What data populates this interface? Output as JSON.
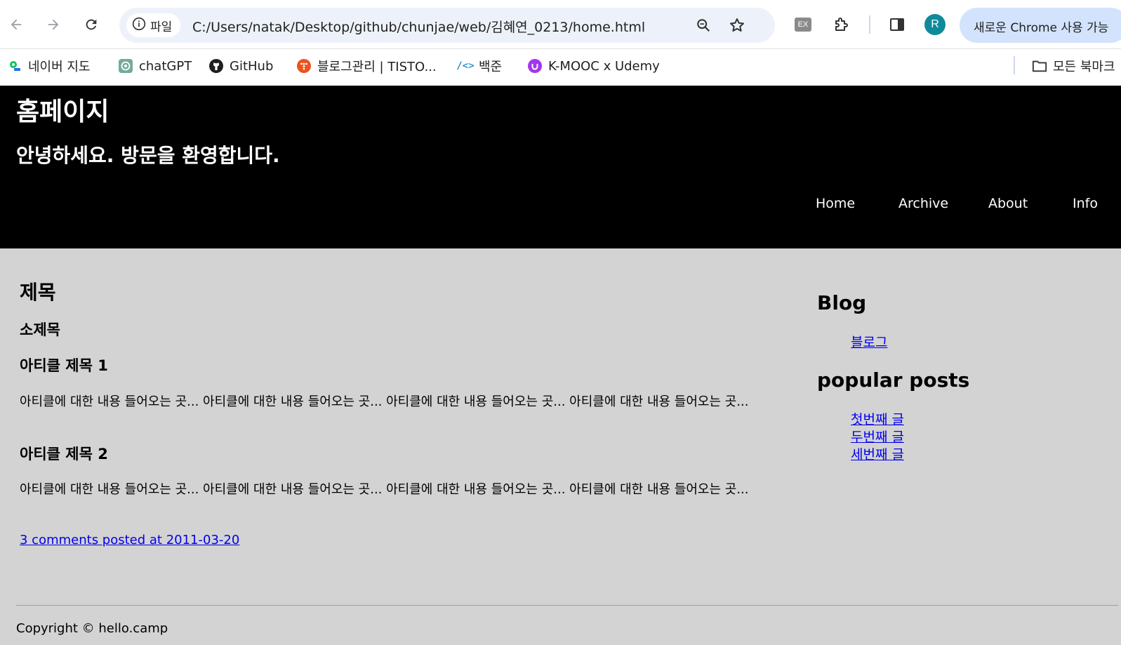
{
  "browser": {
    "chip_label": "파일",
    "url": "C:/Users/natak/Desktop/github/chunjae/web/김혜연_0213/home.html",
    "profile_initial": "R",
    "promo_text": "새로운 Chrome 사용 가능",
    "ext_label": "EX",
    "accent_color": "#d3e3fd"
  },
  "bookmarks": {
    "items": [
      {
        "label": "네이버 지도",
        "icon": "naver-map-icon"
      },
      {
        "label": "chatGPT",
        "icon": "chatgpt-icon"
      },
      {
        "label": "GitHub",
        "icon": "github-icon"
      },
      {
        "label": "블로그관리 | TISTO...",
        "icon": "tistory-icon"
      },
      {
        "label": "백준",
        "icon": "baekjoon-icon"
      },
      {
        "label": "K-MOOC x Udemy",
        "icon": "udemy-icon"
      }
    ],
    "all_bookmarks": "모든 북마크"
  },
  "header": {
    "title": "홈페이지",
    "subtitle": "안녕하세요. 방문을 환영합니다.",
    "nav": [
      "Home",
      "Archive",
      "About",
      "Info"
    ]
  },
  "main": {
    "title": "제목",
    "subtitle": "소제목",
    "articles": [
      {
        "title": "아티클 제목 1",
        "body": "아티클에 대한 내용 들어오는 곳... 아티클에 대한 내용 들어오는 곳... 아티클에 대한 내용 들어오는 곳... 아티클에 대한 내용 들어오는 곳..."
      },
      {
        "title": "아티클 제목 2",
        "body": "아티클에 대한 내용 들어오는 곳... 아티클에 대한 내용 들어오는 곳... 아티클에 대한 내용 들어오는 곳... 아티클에 대한 내용 들어오는 곳..."
      }
    ],
    "comments_link": "3 comments posted at 2011-03-20"
  },
  "aside": {
    "blog_heading": "Blog",
    "blog_link": "블로그",
    "popular_heading": "popular posts",
    "popular_links": [
      "첫번째 글",
      "두번째 글",
      "세번째 글"
    ]
  },
  "footer": {
    "copyright": "Copyright © hello.camp"
  }
}
